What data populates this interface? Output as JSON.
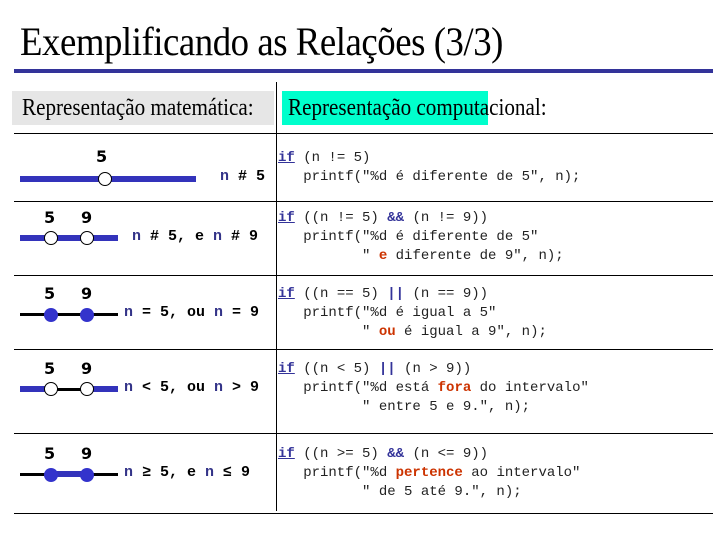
{
  "title": "Exemplificando as Relações (3/3)",
  "headers": {
    "math": "Representação matemática:",
    "computational": "Representação computacional:"
  },
  "colors": {
    "rule": "#333399",
    "math_header_bg": "#e6e6e6",
    "comp_header_bg": "#00ffcc",
    "highlight": "#cc3300",
    "variable": "#333388"
  },
  "rows": [
    {
      "points": [
        "5"
      ],
      "math": {
        "parts": [
          "n",
          " # 5"
        ]
      },
      "code": {
        "kw": "if",
        "cond_a": " (n != 5)",
        "op": "",
        "cond_b": "",
        "line2_pre": "   printf(\"%d é diferente de 5\", n);",
        "line2_hl": "",
        "line2_post": "",
        "line3_pre": "",
        "line3_hl": "",
        "line3_post": ""
      }
    },
    {
      "points": [
        "5",
        "9"
      ],
      "math": {
        "parts": [
          "n",
          " # 5, e ",
          "n",
          " # 9"
        ]
      },
      "code": {
        "kw": "if",
        "cond_a": " ((n != 5) ",
        "op": "&&",
        "cond_b": " (n != 9))",
        "line2_pre": "   printf(\"%d é diferente de 5\"",
        "line2_hl": "",
        "line2_post": "",
        "line3_pre": "          \" ",
        "line3_hl": "e",
        "line3_post": " diferente de 9\", n);"
      }
    },
    {
      "points": [
        "5",
        "9"
      ],
      "math": {
        "parts": [
          "n",
          " = 5, ou ",
          "n",
          " = 9"
        ]
      },
      "code": {
        "kw": "if",
        "cond_a": " ((n == 5) ",
        "op": "||",
        "cond_b": " (n == 9))",
        "line2_pre": "   printf(\"%d é igual a 5\"",
        "line2_hl": "",
        "line2_post": "",
        "line3_pre": "          \" ",
        "line3_hl": "ou",
        "line3_post": " é igual a 9\", n);"
      }
    },
    {
      "points": [
        "5",
        "9"
      ],
      "math": {
        "parts": [
          "n",
          " < 5, ou ",
          "n",
          " > 9"
        ]
      },
      "code": {
        "kw": "if",
        "cond_a": " ((n < 5) ",
        "op": "||",
        "cond_b": " (n > 9))",
        "line2_pre": "   printf(\"%d está ",
        "line2_hl": "fora",
        "line2_post": " do intervalo\"",
        "line3_pre": "          \" entre 5 e 9.\", n);",
        "line3_hl": "",
        "line3_post": ""
      }
    },
    {
      "points": [
        "5",
        "9"
      ],
      "math": {
        "parts": [
          "n",
          " ≥ 5, e ",
          "n",
          " ≤ 9"
        ]
      },
      "code": {
        "kw": "if",
        "cond_a": " ((n >= 5) ",
        "op": "&&",
        "cond_b": " (n <= 9))",
        "line2_pre": "   printf(\"%d ",
        "line2_hl": "pertence",
        "line2_post": " ao intervalo\"",
        "line3_pre": "          \" de 5 até 9.\", n);",
        "line3_hl": "",
        "line3_post": ""
      }
    }
  ]
}
